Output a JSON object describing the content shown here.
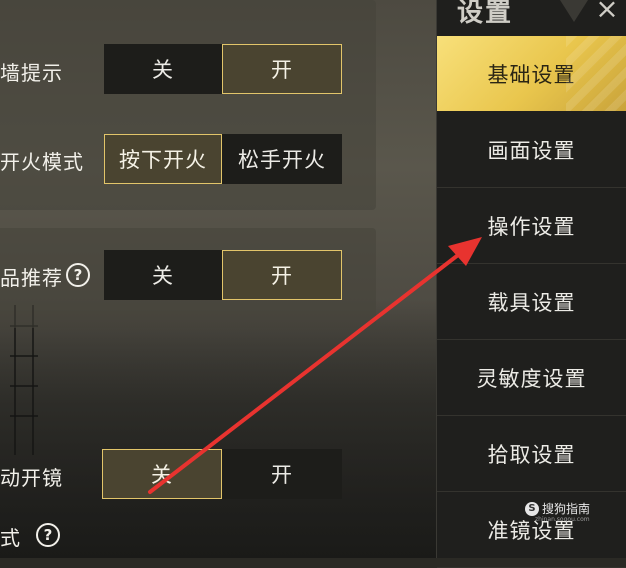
{
  "settings": {
    "rows": [
      {
        "label": "墙提示",
        "off": "关",
        "on": "开",
        "selected": "on"
      },
      {
        "label": "开火模式",
        "off": "按下开火",
        "on": "松手开火",
        "selected": "off"
      },
      {
        "label": "品推荐",
        "off": "关",
        "on": "开",
        "selected": "on",
        "help": "?"
      },
      {
        "label": "动开镜",
        "off": "关",
        "on": "开",
        "selected": "off"
      },
      {
        "label": "式",
        "help": "?"
      }
    ]
  },
  "sidebar": {
    "title": "设置",
    "close_label": "×",
    "items": [
      {
        "label": "基础设置",
        "active": true
      },
      {
        "label": "画面设置",
        "active": false
      },
      {
        "label": "操作设置",
        "active": false
      },
      {
        "label": "载具设置",
        "active": false
      },
      {
        "label": "灵敏度设置",
        "active": false
      },
      {
        "label": "拾取设置",
        "active": false
      },
      {
        "label": "准镜设置",
        "active": false
      }
    ]
  },
  "watermark": {
    "logo": "S",
    "text": "搜狗指南",
    "url": "zhinan.sogou.com"
  },
  "colors": {
    "accent": "#e2c56a",
    "active_menu": "#f1d25e",
    "annotation_arrow": "#e8332f"
  }
}
